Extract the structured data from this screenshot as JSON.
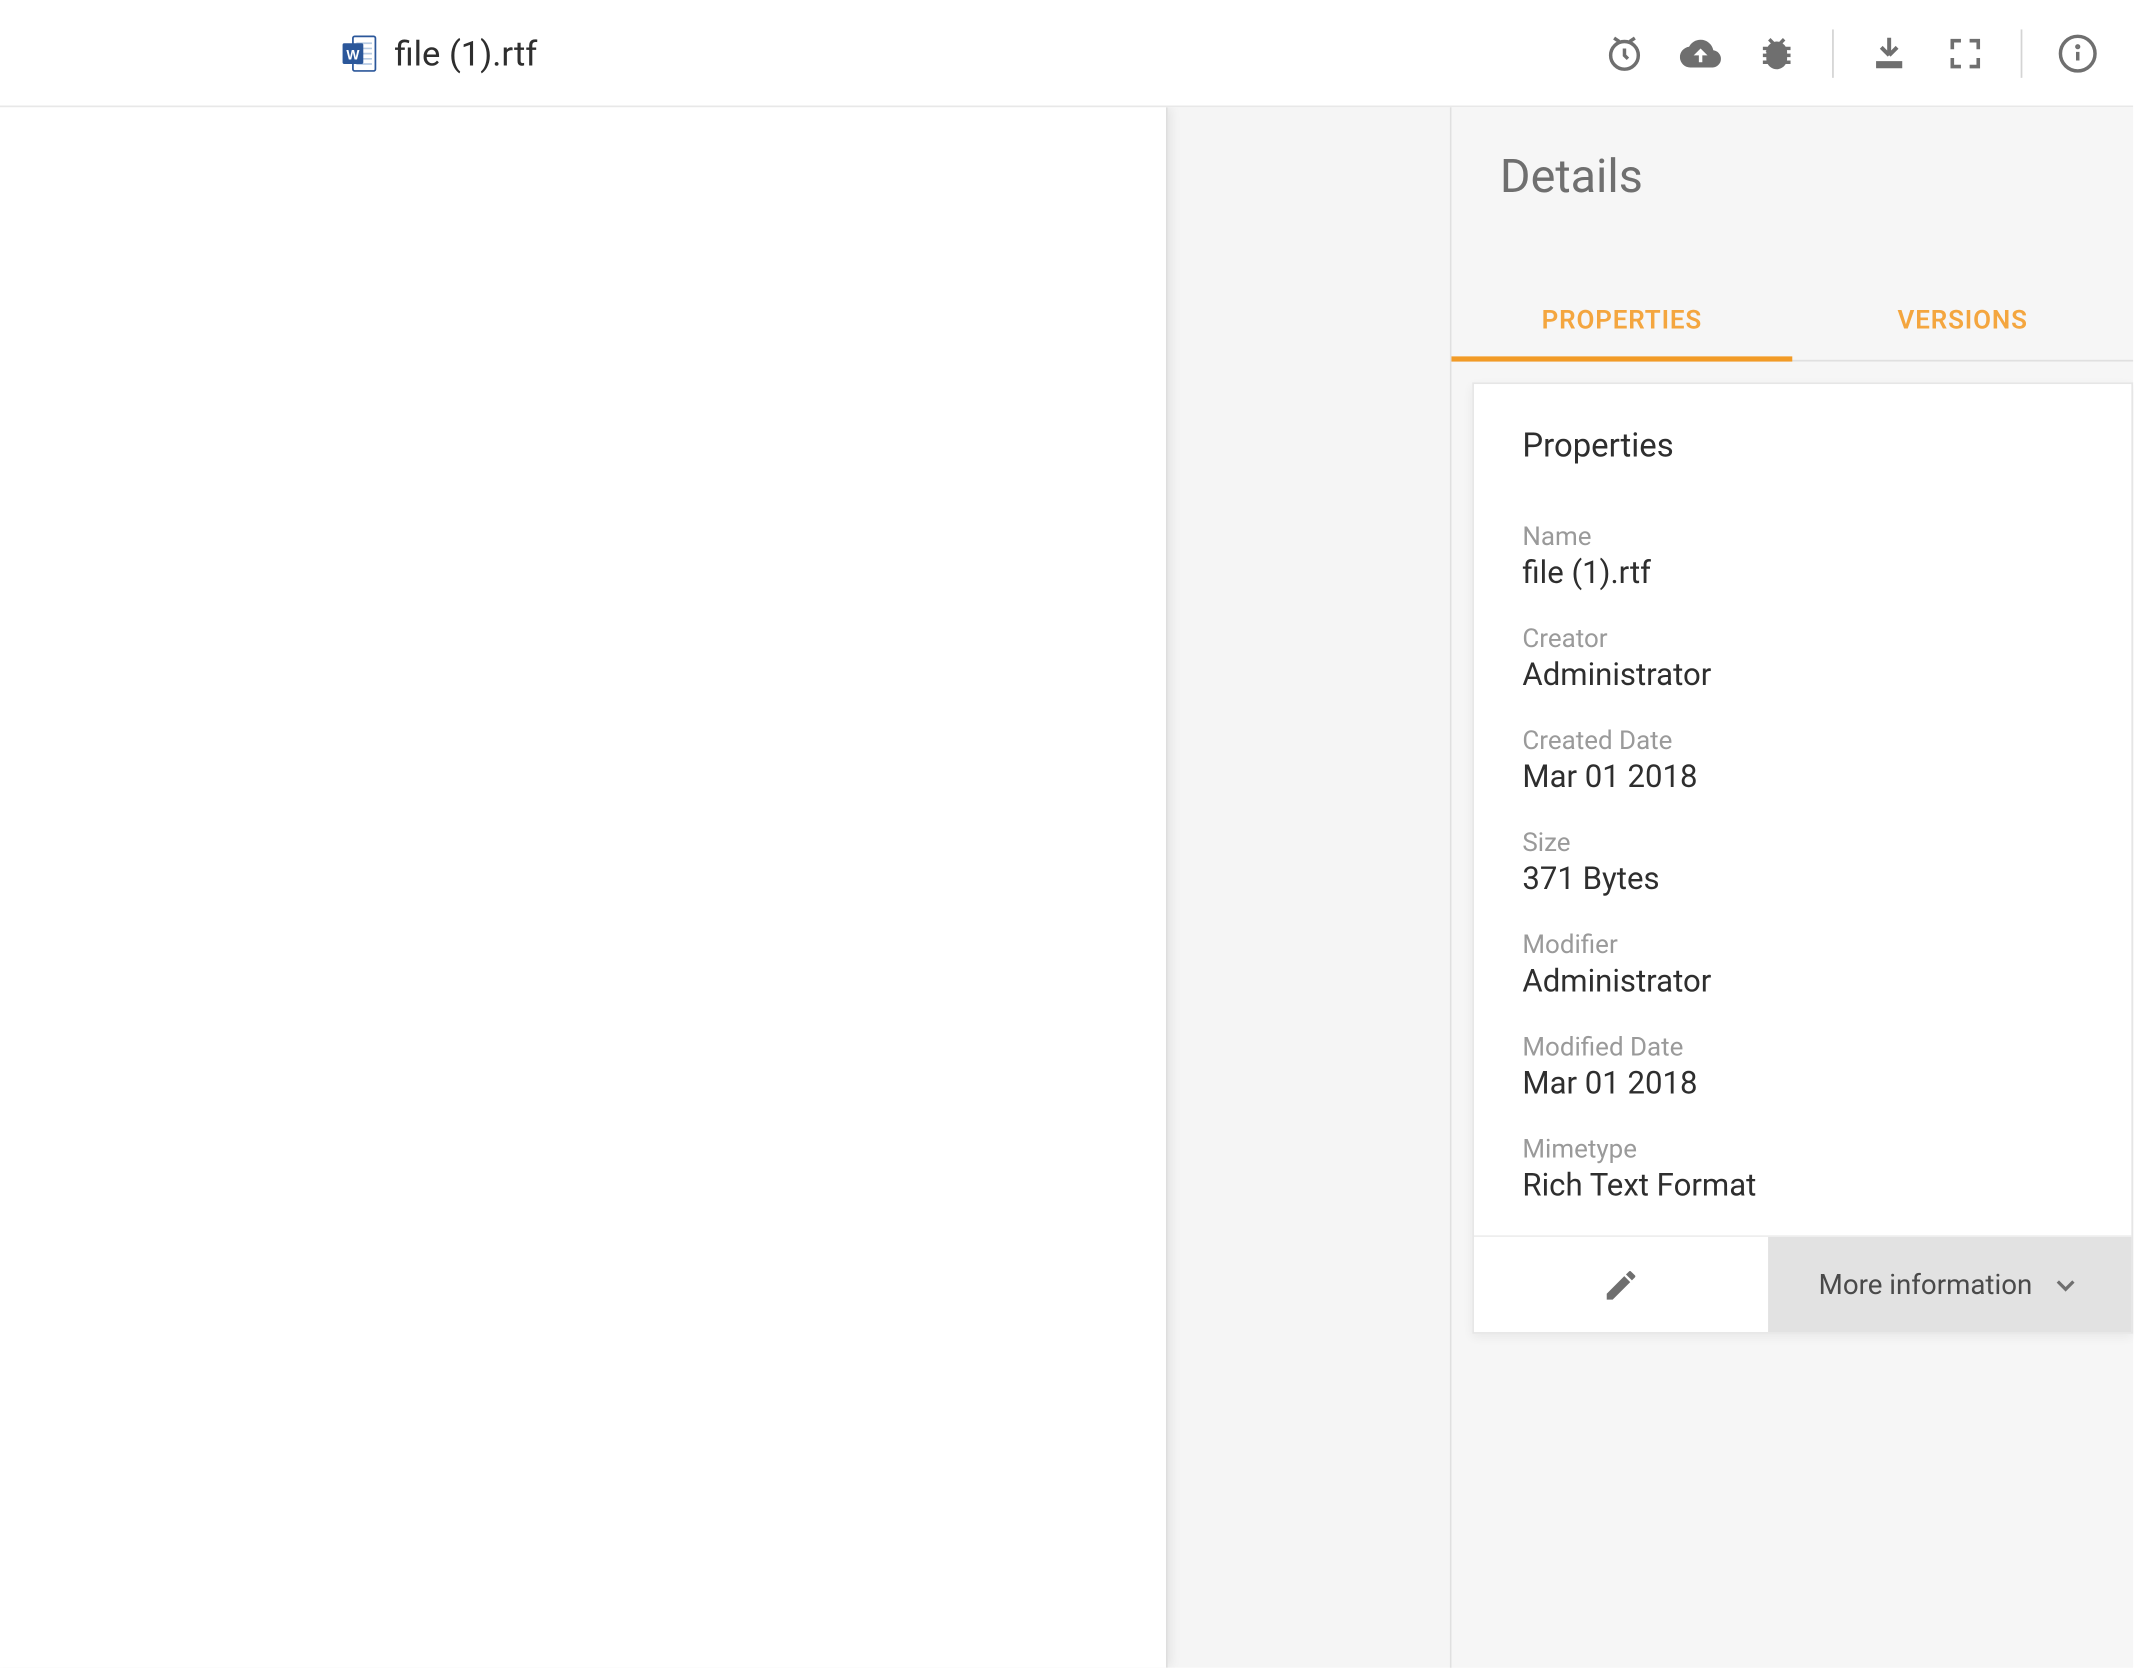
{
  "header": {
    "file_name": "file (1).rtf"
  },
  "details": {
    "heading": "Details",
    "tabs": {
      "properties": "PROPERTIES",
      "versions": "VERSIONS"
    },
    "card_title": "Properties",
    "fields": {
      "name": {
        "label": "Name",
        "value": "file (1).rtf"
      },
      "creator": {
        "label": "Creator",
        "value": "Administrator"
      },
      "created_date": {
        "label": "Created Date",
        "value": "Mar 01 2018"
      },
      "size": {
        "label": "Size",
        "value": "371 Bytes"
      },
      "modifier": {
        "label": "Modifier",
        "value": "Administrator"
      },
      "modified_date": {
        "label": "Modified Date",
        "value": "Mar 01 2018"
      },
      "mimetype": {
        "label": "Mimetype",
        "value": "Rich Text Format"
      }
    },
    "more_info": "More information"
  }
}
